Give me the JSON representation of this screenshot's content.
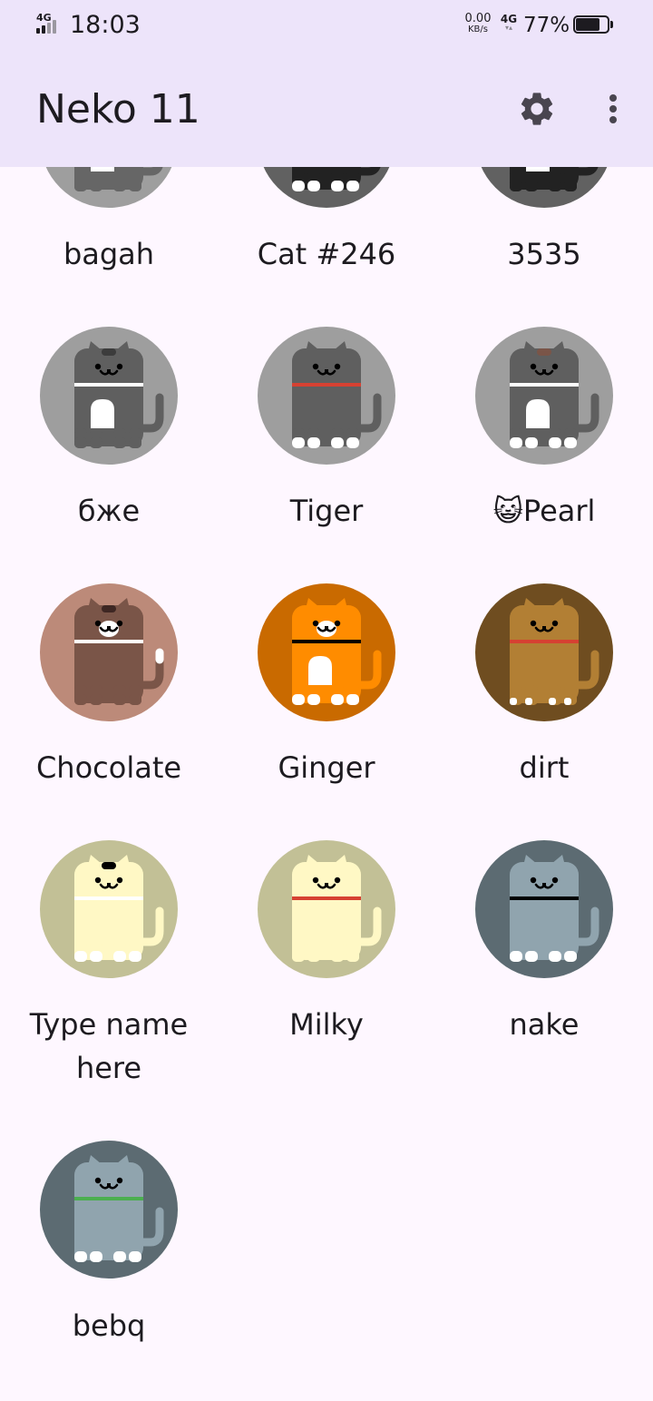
{
  "status_bar": {
    "network_label": "4G",
    "time": "18:03",
    "speed_value": "0.00",
    "speed_unit": "KB/s",
    "network_type": "4G",
    "battery_percent": "77%",
    "battery_level": 0.77
  },
  "app_bar": {
    "title": "Neko 11",
    "settings_icon": "gear-icon",
    "more_icon": "more-vert-icon"
  },
  "cats": [
    {
      "name": "bagah",
      "bg": "#9E9E9E",
      "body": "#666666",
      "face": "#000000",
      "collar": "#FFFFFF",
      "belly": "#FFFFFF",
      "spot": "none",
      "feet": "#666666"
    },
    {
      "name": "Cat #246",
      "bg": "#616161",
      "body": "#222222",
      "face": "#000000",
      "collar": "#222222",
      "belly": "none",
      "spot": "none",
      "feet": "#FFFFFF"
    },
    {
      "name": "3535",
      "bg": "#616161",
      "body": "#222222",
      "face": "#000000",
      "collar": "#222222",
      "belly": "#FFFFFF",
      "spot": "none",
      "feet": "#222222"
    },
    {
      "name": "бже",
      "bg": "#9E9E9E",
      "body": "#5F5F5F",
      "face": "#000000",
      "collar": "#FFFFFF",
      "belly": "#FFFFFF",
      "spot": "#3C3C3C",
      "feet": "#5F5F5F"
    },
    {
      "name": "Tiger",
      "bg": "#9E9E9E",
      "body": "#5F5F5F",
      "face": "#000000",
      "collar": "#D64132",
      "belly": "none",
      "spot": "none",
      "feet": "#FFFFFF"
    },
    {
      "name": "Pearl",
      "name_emoji": "😺",
      "bg": "#9E9E9E",
      "body": "#5F5F5F",
      "face": "#000000",
      "collar": "#FFFFFF",
      "belly": "#FFFFFF",
      "spot": "#7A5548",
      "feet": "#FFFFFF"
    },
    {
      "name": "Chocolate",
      "bg": "#BC8A79",
      "body": "#7A5548",
      "face": "#000000",
      "collar": "#FFFFFF",
      "belly": "none",
      "spot": "#3E2723",
      "feet": "#7A5548",
      "muzzle": "#FFFFFF",
      "tail_tip": "#FFFFFF"
    },
    {
      "name": "Ginger",
      "bg": "#C96A00",
      "body": "#FF8C00",
      "face": "#000000",
      "collar": "#000000",
      "belly": "#FFFFFF",
      "spot": "none",
      "feet": "#FFFFFF",
      "muzzle": "#FFFFFF"
    },
    {
      "name": "dirt",
      "bg": "#6F4D20",
      "body": "#B27F34",
      "face": "#000000",
      "collar": "#D64132",
      "belly": "none",
      "spot": "none",
      "feet": "#B27F34",
      "foot_tip": "#FFFFFF"
    },
    {
      "name": "Type name here",
      "bg": "#C2C096",
      "body": "#FFF8C5",
      "face": "#000000",
      "collar": "#FFFFFF",
      "belly": "none",
      "spot": "#000000",
      "feet": "#FFFFFF"
    },
    {
      "name": "Milky",
      "bg": "#C2C096",
      "body": "#FFF8C5",
      "face": "#000000",
      "collar": "#D64132",
      "belly": "none",
      "spot": "none",
      "feet": "#FFF8C5"
    },
    {
      "name": "nake",
      "bg": "#5C6B72",
      "body": "#90A4AE",
      "face": "#000000",
      "collar": "#000000",
      "belly": "none",
      "spot": "none",
      "feet": "#FFFFFF"
    },
    {
      "name": "bebq",
      "bg": "#5C6B72",
      "body": "#90A4AE",
      "face": "#000000",
      "collar": "#4CAF50",
      "belly": "none",
      "spot": "none",
      "feet": "#FFFFFF"
    }
  ]
}
